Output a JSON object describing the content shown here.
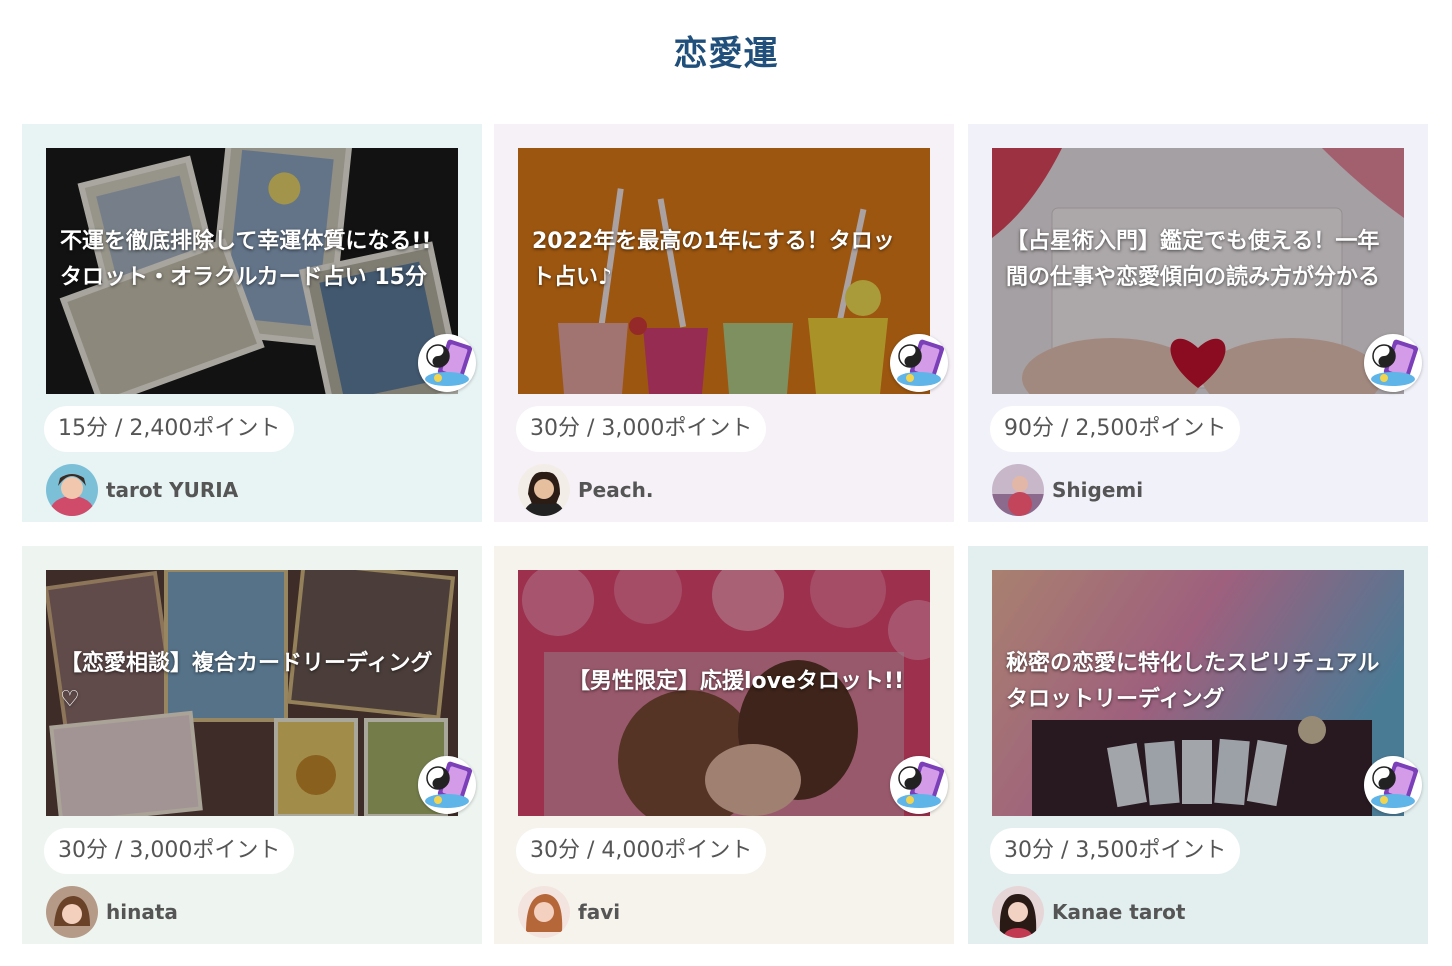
{
  "section": {
    "title": "恋愛運"
  },
  "cards": [
    {
      "title": "不運を徹底排除して幸運体質になる!! タロット・オラクルカード占い 15分",
      "price": "15分 / 2,400ポイント",
      "author": "tarot YURIA",
      "bg": "#e8f3f3",
      "icon": "yin-yang-tarot-badge"
    },
    {
      "title": "2022年を最高の1年にする！タロット占い♪",
      "price": "30分 / 3,000ポイント",
      "author": "Peach.",
      "bg": "#f6f1f7",
      "icon": "yin-yang-tarot-badge"
    },
    {
      "title": "【占星術入門】鑑定でも使える！一年間の仕事や恋愛傾向の読み方が分かる",
      "price": "90分 / 2,500ポイント",
      "author": "Shigemi",
      "bg": "#f1f1fa",
      "icon": "yin-yang-tarot-badge"
    },
    {
      "title": "【恋愛相談】複合カードリーディング♡",
      "price": "30分 / 3,000ポイント",
      "author": "hinata",
      "bg": "#eef5f1",
      "icon": "yin-yang-tarot-badge"
    },
    {
      "title": "【男性限定】応援loveタロット!!",
      "price": "30分 / 4,000ポイント",
      "author": "favi",
      "bg": "#f5f3ec",
      "icon": "yin-yang-tarot-badge"
    },
    {
      "title": "秘密の恋愛に特化したスピリチュアルタロットリーディング",
      "price": "30分 / 3,500ポイント",
      "author": "Kanae tarot",
      "bg": "#e3efef",
      "icon": "yin-yang-tarot-badge"
    }
  ]
}
